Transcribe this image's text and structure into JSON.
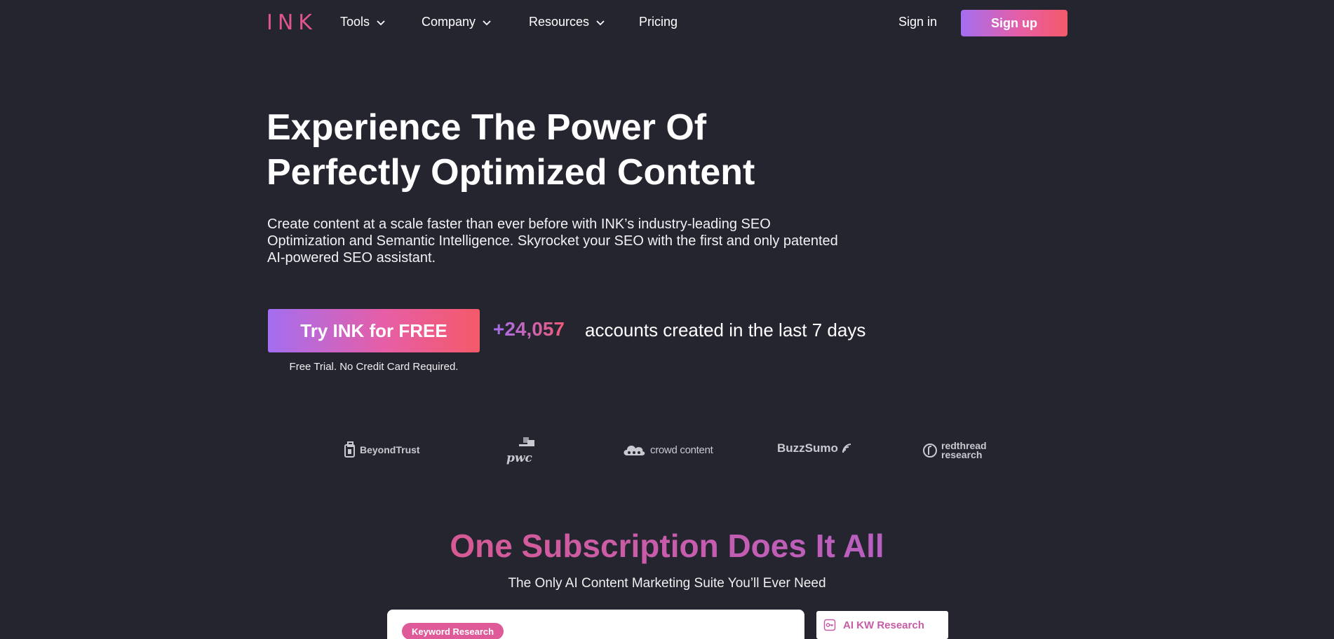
{
  "nav": {
    "logo": "INK",
    "items": [
      {
        "label": "Tools",
        "has_dropdown": true
      },
      {
        "label": "Company",
        "has_dropdown": true
      },
      {
        "label": "Resources",
        "has_dropdown": true
      },
      {
        "label": "Pricing",
        "has_dropdown": false
      }
    ],
    "sign_in": "Sign in",
    "sign_up": "Sign up"
  },
  "hero": {
    "title_line1": "Experience The Power Of",
    "title_line2": "Perfectly Optimized Content",
    "subtitle": "Create content at a scale faster than ever before with INK’s industry-leading SEO Optimization and Semantic Intelligence. Skyrocket your SEO with the first and only patented AI-powered SEO assistant.",
    "cta_label": "Try INK for FREE",
    "cta_note": "Free Trial. No Credit Card Required.",
    "account_count": "+24,057",
    "account_text": "accounts created in the last 7 days"
  },
  "logos": [
    {
      "name": "BeyondTrust"
    },
    {
      "name": "pwc"
    },
    {
      "name": "crowd content"
    },
    {
      "name": "BuzzSumo"
    },
    {
      "name_line1": "redthread",
      "name_line2": "research"
    }
  ],
  "section": {
    "title": "One Subscription Does It All",
    "subtitle": "The Only AI Content Marketing Suite You’ll Ever Need",
    "pill_label": "Keyword Research",
    "side_tab_label": "AI KW Research"
  },
  "colors": {
    "background": "#252530",
    "logo_pink": "#e0558f",
    "gradient_start": "#a46ef0",
    "gradient_end": "#f45a6a"
  }
}
